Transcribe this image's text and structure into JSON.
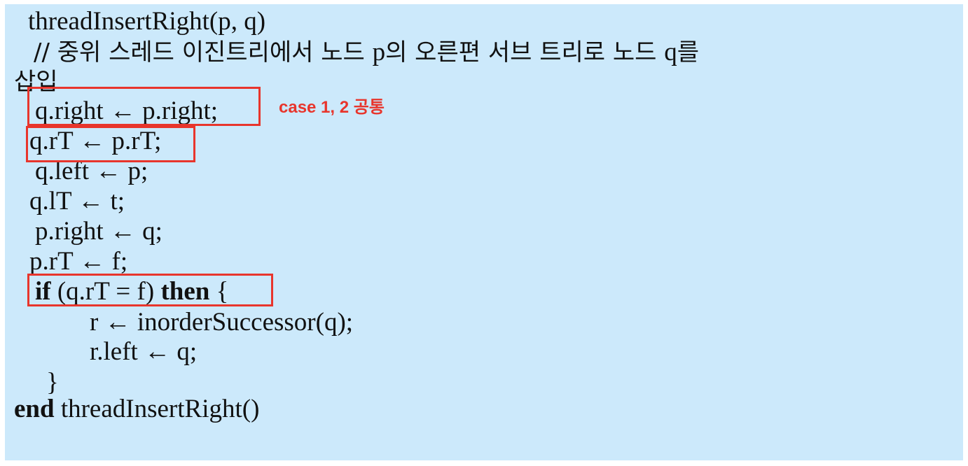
{
  "code": {
    "header": "threadInsertRight(p, q)",
    "comment": {
      "prefix": "// 중위 스레드 이진트리에서 노드 ",
      "var_p": "p",
      "middle": "의 오른편 서브 트리로 노드 ",
      "var_q": "q",
      "suffix": "를",
      "wrap": "삽입"
    },
    "line1": "q.right ← p.right;",
    "line2": "q.rT ← p.rT;",
    "line3": "q.left ← p;",
    "line4": "q.lT ← t;",
    "line5": "p.right ← q;",
    "line6": "p.rT ← f;",
    "if_kw": "if",
    "if_cond": " (q.rT = f) ",
    "then_kw": "then",
    "if_brace": " {",
    "inner1": "r ← inorderSuccessor(q);",
    "inner2": "r.left ← q;",
    "close_brace": "}",
    "end_kw": "end",
    "end_name": " threadInsertRight()"
  },
  "annotation": {
    "note": "case 1, 2 공통"
  },
  "colors": {
    "background": "#cce9fb",
    "highlight_box": "#e8352c",
    "text": "#111111"
  }
}
